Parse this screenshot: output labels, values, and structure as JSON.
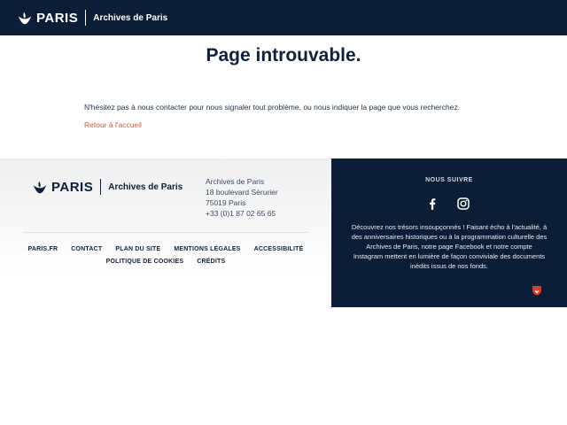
{
  "header": {
    "logo_text": "PARIS",
    "org_name": "Archives de Paris",
    "logo_icon": "paris-boat-logo-icon"
  },
  "main": {
    "title": "Page introuvable.",
    "message": "N'hésitez pas à nous contacter pour nous signaler tout problème, ou nous indiquer la page que vous recherchez.",
    "home_link": "Retour à l'accueil"
  },
  "footer": {
    "logo_text": "PARIS",
    "org_name": "Archives de Paris",
    "address": {
      "name": "Archives de Paris",
      "street": "18 boulevard Sérurier",
      "city": "75019 Paris",
      "phone": "+33 (0)1 87 02 65 65"
    },
    "links": [
      "PARIS.FR",
      "CONTACT",
      "PLAN DU SITE",
      "MENTIONS LÉGALES",
      "ACCESSIBILITÉ",
      "POLITIQUE DE COOKIES",
      "CRÉDITS"
    ],
    "follow": {
      "title": "NOUS SUIVRE",
      "icons": [
        "facebook-icon",
        "instagram-icon"
      ],
      "text": "Découvrez nos trésors insoupçonnés ! Faisant écho à l'actualité, à des anniversaires historiques ou à la programmation culturelle des Archives de Paris, notre page Facebook et notre compte Instagram mettent en lumière de façon conviviale des documents inédits issus de nos fonds."
    },
    "badge_icon": "paris-shield-icon"
  },
  "colors": {
    "navy": "#0b1e36",
    "link": "#c55a3a",
    "badge": "#e0382e"
  }
}
